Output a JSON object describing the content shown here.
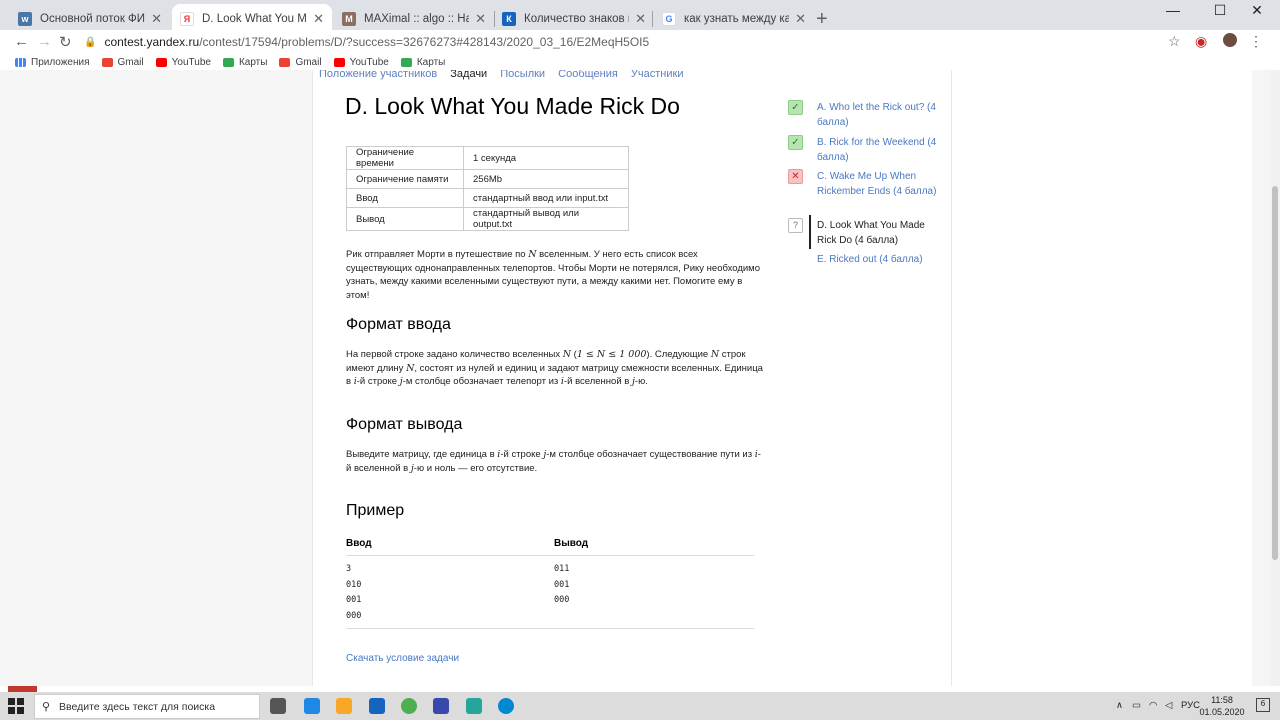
{
  "browser": {
    "tabs": [
      {
        "title": "Основной поток ФИВТ",
        "color": "#4a76a8",
        "glyph": "vk"
      },
      {
        "title": "D. Look What You Made Rick Do",
        "color": "#ff3333",
        "glyph": "Я"
      },
      {
        "title": "MAXimal :: algo :: Нахождение к",
        "color": "#8d6e63",
        "glyph": "M"
      },
      {
        "title": "Количество знаков после запя",
        "color": "#1565c0",
        "glyph": "К"
      },
      {
        "title": "как узнать между какими верш",
        "color": "#4285f4",
        "glyph": "G"
      }
    ],
    "url_host": "contest.yandex.ru",
    "url_path": "/contest/17594/problems/D/?success=32676273#428143/2020_03_16/E2MeqH5OI5",
    "bookmarks": [
      {
        "label": "Приложения",
        "color": "#4285f4"
      },
      {
        "label": "Gmail",
        "color": "#ea4335"
      },
      {
        "label": "YouTube",
        "color": "#ff0000"
      },
      {
        "label": "Карты",
        "color": "#34a853"
      },
      {
        "label": "Gmail",
        "color": "#ea4335"
      },
      {
        "label": "YouTube",
        "color": "#ff0000"
      },
      {
        "label": "Карты",
        "color": "#34a853"
      }
    ]
  },
  "subnav": {
    "items": [
      "Положение участников",
      "Задачи",
      "Посылки",
      "Сообщения",
      "Участники"
    ],
    "current": "Задачи"
  },
  "problem": {
    "title": "D. Look What You Made Rick Do",
    "limits": [
      {
        "key": "Ограничение времени",
        "value": "1 секунда"
      },
      {
        "key": "Ограничение памяти",
        "value": "256Mb"
      },
      {
        "key": "Ввод",
        "value": "стандартный ввод или input.txt"
      },
      {
        "key": "Вывод",
        "value": "стандартный вывод или output.txt"
      }
    ],
    "statement": {
      "p1": "Рик отправляет Морти в путешествие по ",
      "N": "N",
      "p2": " вселенным. У него есть список всех существующих однонаправленных телепортов. Чтобы Морти не потерялся, Рику необходимо узнать, между какими вселенными существуют пути, а между какими нет. Помогите ему в этом!"
    },
    "input_heading": "Формат ввода",
    "input_text": {
      "a": "На первой строке задано количество вселенных ",
      "n1": "N",
      "b": " (",
      "range": "1 ≤ N ≤ 1 000",
      "c": "). Следующие ",
      "n2": "N",
      "d": " строк имеют длину ",
      "n3": "N",
      "e": ", состоят из нулей и единиц и задают матрицу смежности вселенных. Единица в ",
      "i1": "i",
      "f": "-й строке ",
      "j1": "j",
      "g": "-м столбце обозначает телепорт из ",
      "i2": "i",
      "h": "-й вселенной в ",
      "j2": "j",
      "k": "-ю."
    },
    "output_heading": "Формат вывода",
    "output_text": {
      "a": "Выведите матрицу, где единица в ",
      "i1": "i",
      "b": "-й строке ",
      "j1": "j",
      "c": "-м столбце обозначает существование пути из ",
      "i2": "i",
      "d": "-й вселенной в ",
      "j2": "j",
      "e": "-ю и ноль — его отсутствие."
    },
    "example_heading": "Пример",
    "example": {
      "input_label": "Ввод",
      "output_label": "Вывод",
      "input": "3\n010\n001\n000",
      "output": "011\n001\n000"
    },
    "download": "Скачать условие задачи"
  },
  "problem_list": [
    {
      "label": "A. Who let the Rick out? (4 балла)",
      "status": "ok",
      "mark": "✓"
    },
    {
      "label": "B. Rick for the Weekend (4 балла)",
      "status": "ok",
      "mark": "✓"
    },
    {
      "label": "C. Wake Me Up When Rickember Ends (4 балла)",
      "status": "fail",
      "mark": "✕"
    },
    {
      "label": "D. Look What You Made Rick Do (4 балла)",
      "status": "current",
      "mark": "?"
    },
    {
      "label": "E. Ricked out (4 балла)",
      "status": "none",
      "mark": ""
    }
  ],
  "taskbar": {
    "search_placeholder": "Введите здесь текст для поиска",
    "lang": "РУС",
    "time": "11:58",
    "date": "01.05.2020",
    "notifications": "6"
  }
}
